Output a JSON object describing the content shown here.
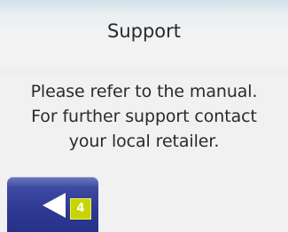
{
  "screen": {
    "title": "Support",
    "message_lines": [
      "Please refer to the manual.",
      "For further support contact",
      "your local retailer."
    ]
  },
  "back_button": {
    "icon": "back-arrow-icon",
    "badge": "4"
  },
  "colors": {
    "button_blue": "#2d3890",
    "badge_green": "#c8d400",
    "background": "#f1f1f1"
  }
}
